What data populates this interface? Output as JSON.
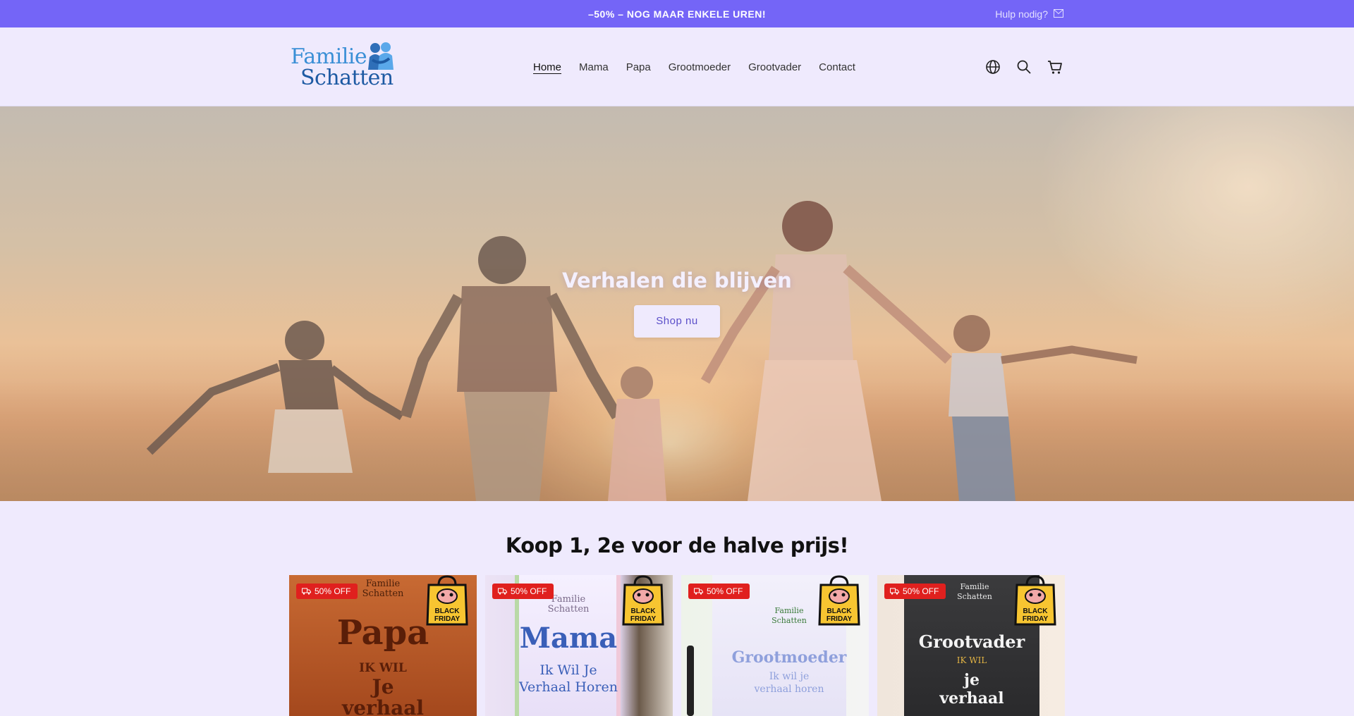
{
  "announcement": {
    "promo_text": "–50% – NOG MAAR ENKELE UREN!",
    "help_text": "Hulp nodig?",
    "help_icon": "mail-icon"
  },
  "header": {
    "logo_line1": "Familie",
    "logo_line2": "Schatten",
    "nav": [
      {
        "label": "Home",
        "active": true
      },
      {
        "label": "Mama",
        "active": false
      },
      {
        "label": "Papa",
        "active": false
      },
      {
        "label": "Grootmoeder",
        "active": false
      },
      {
        "label": "Grootvader",
        "active": false
      },
      {
        "label": "Contact",
        "active": false
      }
    ],
    "icons": [
      "globe-icon",
      "search-icon",
      "cart-icon"
    ]
  },
  "hero": {
    "title": "Verhalen die blijven",
    "button_label": "Shop nu"
  },
  "products_section": {
    "title": "Koop 1, 2e voor de halve prijs!",
    "products": [
      {
        "badge": "50% OFF",
        "brand_line1": "Familie",
        "brand_line2": "Schatten",
        "book_title": "Papa",
        "book_sub1": "IK WIL",
        "book_sub2": "Je",
        "book_sub3": "verhaal",
        "sticker_line1": "BLACK",
        "sticker_line2": "FRIDAY"
      },
      {
        "badge": "50% OFF",
        "brand_line1": "Familie",
        "brand_line2": "Schatten",
        "book_title": "Mama",
        "book_sub1": "Ik Wil Je",
        "book_sub2": "Verhaal Horen",
        "book_sub3": "",
        "sticker_line1": "BLACK",
        "sticker_line2": "FRIDAY"
      },
      {
        "badge": "50% OFF",
        "brand_line1": "Familie",
        "brand_line2": "Schatten",
        "book_title": "Grootmoeder",
        "book_sub1": "Ik wil je",
        "book_sub2": "verhaal horen",
        "book_sub3": "",
        "sticker_line1": "BLACK",
        "sticker_line2": "FRIDAY"
      },
      {
        "badge": "50% OFF",
        "brand_line1": "Familie",
        "brand_line2": "Schatten",
        "book_title": "Grootvader",
        "book_sub1": "IK WIL",
        "book_sub2": "je",
        "book_sub3": "verhaal",
        "sticker_line1": "BLACK",
        "sticker_line2": "FRIDAY"
      }
    ]
  },
  "colors": {
    "announcement_bg": "#7465f7",
    "page_bg": "#efeafd",
    "badge_red": "#e0201e",
    "accent_text": "#5b4fc9"
  }
}
